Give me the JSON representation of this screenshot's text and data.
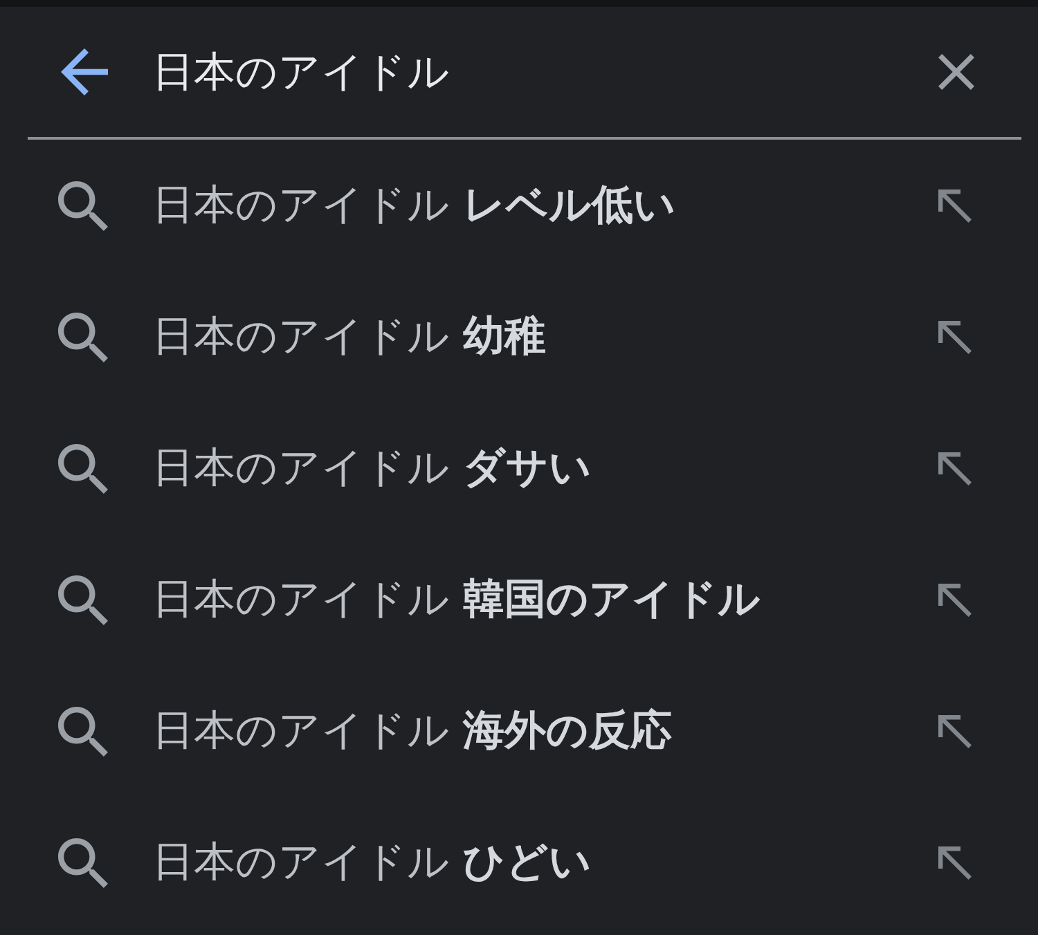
{
  "search": {
    "value": "日本のアイドル"
  },
  "suggestions": [
    {
      "text": "日本のアイドル **レベル低い**"
    },
    {
      "text": "日本のアイドル **幼稚**"
    },
    {
      "text": "日本のアイドル **ダサい**"
    },
    {
      "text": "日本のアイドル **韓国のアイドル**"
    },
    {
      "text": "日本のアイドル **海外の反応**"
    },
    {
      "text": "日本のアイドル **ひどい**"
    }
  ]
}
